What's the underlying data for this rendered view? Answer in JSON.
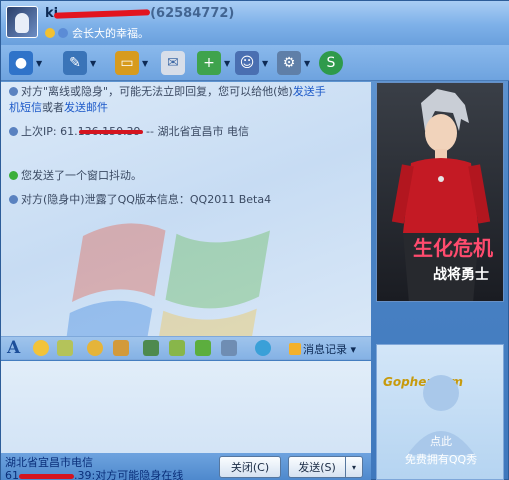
{
  "header": {
    "name_visible": "ki",
    "name_tail": "(62584772)",
    "status_text": "会长大的幸福。"
  },
  "toolbar": {
    "items": [
      {
        "name": "video-call",
        "color": "#2f73c9"
      },
      {
        "name": "voice-call",
        "color": "#3a74b8"
      },
      {
        "name": "send-file",
        "color": "#d79b1e"
      },
      {
        "name": "send-sms",
        "color": "#d7dee9"
      },
      {
        "name": "create-group",
        "color": "#3fa34d"
      },
      {
        "name": "remote-assist",
        "color": "#4a6fb1"
      },
      {
        "name": "apps",
        "color": "#5f7fa8"
      },
      {
        "name": "qq-music",
        "color": "#2e9a4b"
      }
    ]
  },
  "chat": {
    "messages": [
      {
        "prefix": "对方\"离线或隐身\"，可能无法立即回复，您可以给他(她)",
        "link1": "发送手",
        "line2_a": "机短信",
        "mid": "或者",
        "link2": "发送邮件"
      },
      {
        "label": "上次IP: 61",
        "ip_visible": ".136.150.39",
        "rest": " -- 湖北省宜昌市 电信"
      },
      {
        "text": "您发送了一个窗口抖动。"
      },
      {
        "text": "对方(隐身中)泄露了QQ版本信息：QQ2011 Beta4"
      }
    ]
  },
  "format_bar": {
    "font_glyph": "A",
    "history_label": "消息记录",
    "history_arrow": "▾"
  },
  "bottom": {
    "location": "湖北省宜昌市电信",
    "ip_tail": ".39:对方可能隐身在线",
    "ip_head": "61",
    "close_label": "关闭(C)",
    "send_label": "发送(S)",
    "send_arrow": "▾"
  },
  "side": {
    "show_title": "生化危机",
    "show_sub": "战将勇士",
    "watermark": "Gopher.com",
    "click_text": "点此",
    "show_text": "免费拥有QQ秀"
  }
}
